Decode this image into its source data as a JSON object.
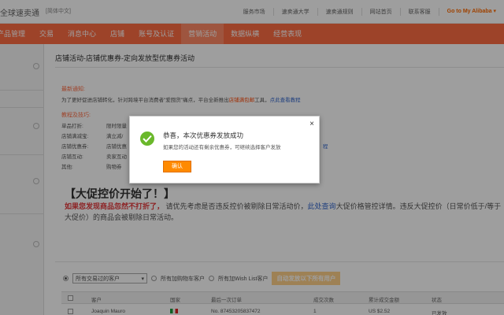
{
  "topbar": {
    "logo": "全球速卖通",
    "lang": "[简体中文]",
    "links": [
      "服务市场",
      "速卖通大学",
      "速卖通规则",
      "网站首页",
      "联系客服"
    ],
    "brand": "Go to My Alibaba ▾"
  },
  "nav": {
    "items": [
      "产品管理",
      "交易",
      "消息中心",
      "店铺",
      "账号及认证",
      "营销活动",
      "数据纵横",
      "经营表现"
    ],
    "active_index": 5
  },
  "page": {
    "title": "店铺活动-店铺优惠券-定向发放型优惠券活动"
  },
  "notice": {
    "title": "最新通知:",
    "text_pre": "为了更好促进店铺转化，针对跨境平台消费者\"爱囤货\"痛点，平台全新推出",
    "text_hl": "店铺满包邮",
    "text_mid": "工具，",
    "text_link": "点此查看教程"
  },
  "tutorial": {
    "title": "教程及技巧:",
    "rows": [
      {
        "label": "单品打折:",
        "value": "限时限量"
      },
      {
        "label": "店铺满减宝:",
        "value": "满立减/"
      },
      {
        "label": "店铺优惠券:",
        "value": "店铺优惠"
      },
      {
        "label": "店铺互动:",
        "value": "卖家互动"
      },
      {
        "label": "其他:",
        "value": "购物券"
      }
    ],
    "link_tail": "程"
  },
  "promo": {
    "heading": "【大促控价开始了！】",
    "red": "如果您发现商品忽然不打折了，",
    "text1": "请优先考虑是否违反控价被剔除日常活动价，",
    "link": "此处查询",
    "text2": "大促价格管控详情。违反大促控价（日常价低于/等于大促价）的商品会被剔除日常活动。"
  },
  "filter": {
    "select_value": "所有交易过的客户",
    "opt_cart": "所有加购物车客户",
    "opt_wish": "所有加Wish List客户",
    "auto_button": "自动发放以下所有用户"
  },
  "table": {
    "headers": [
      "客户",
      "国家",
      "最后一次订单",
      "成交次数",
      "累计成交金额",
      "状态"
    ],
    "row": {
      "customer": "Joaquin Mauro",
      "order": "No. 87453205837472",
      "count": "1",
      "amount": "US $2.52",
      "status": "已发放"
    }
  },
  "dialog": {
    "title": "恭喜，本次优惠券发放成功",
    "message": "如果您的活动还有剩余优惠券，可继续选择客户发放",
    "ok_label": "确认",
    "close_glyph": "×"
  }
}
